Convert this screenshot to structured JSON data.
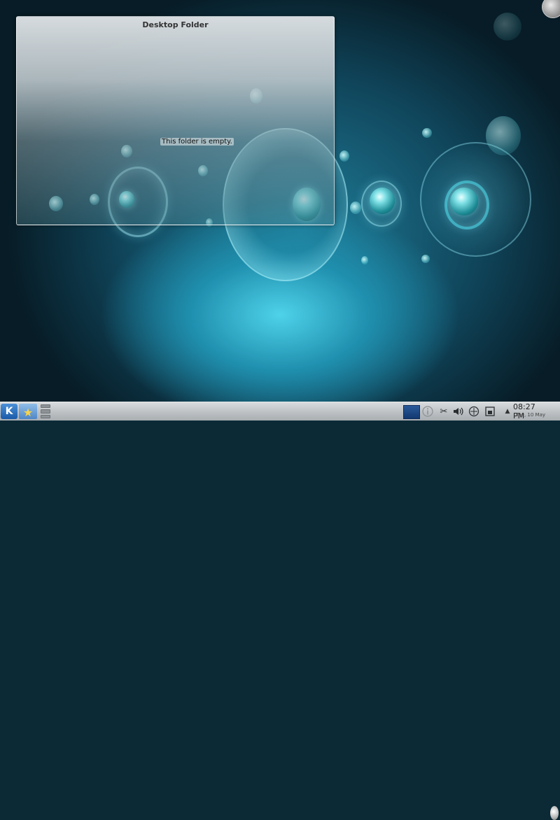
{
  "desktop": {
    "folder_widget": {
      "title": "Desktop Folder",
      "empty_message": "This folder is empty."
    }
  },
  "panel": {
    "kickoff_icon": "kde-logo-icon",
    "favorites_icon": "star-folder-icon",
    "tray": {
      "icons": [
        "info-icon",
        "scissors-icon",
        "volume-icon",
        "network-icon",
        "device-notifier-icon"
      ]
    },
    "clock": {
      "time": "08:27 PM",
      "date": "Tue, 10 May"
    }
  },
  "colors": {
    "panel": "#c4c8cb",
    "desktop_accent": "#4ed2ea",
    "kickoff": "#1b5aa8"
  }
}
